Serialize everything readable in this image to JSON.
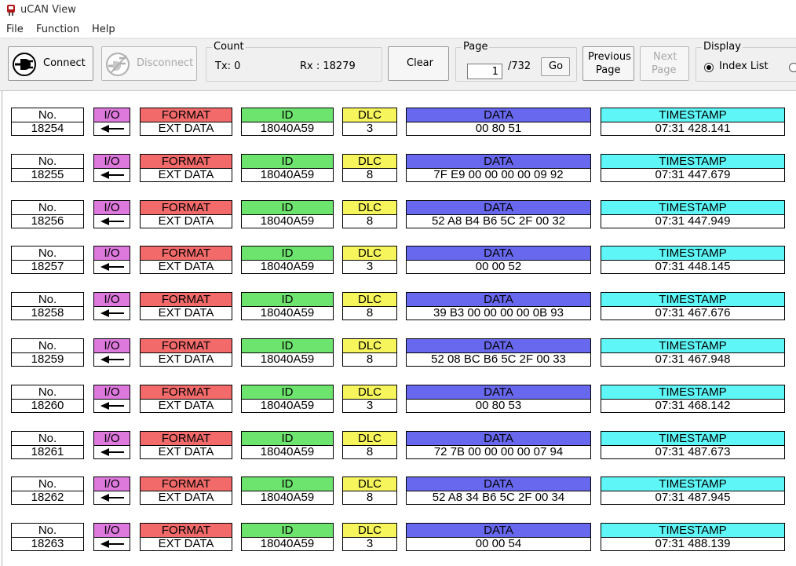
{
  "window": {
    "title": "uCAN View"
  },
  "menu": [
    "File",
    "Function",
    "Help"
  ],
  "toolbar": {
    "connect": "Connect",
    "disconnect": "Disconnect",
    "count": {
      "label": "Count",
      "tx": "Tx:  0",
      "rx": "Rx : 18279"
    },
    "clear": "Clear",
    "page": {
      "label": "Page",
      "current": "1",
      "total": "/732",
      "go": "Go"
    },
    "previous_page": [
      "Previous",
      "Page"
    ],
    "next_page": [
      "Next",
      "Page"
    ],
    "display": {
      "label": "Display",
      "option": "Index List"
    }
  },
  "headers": {
    "no": "No.",
    "io": "I/O",
    "format": "FORMAT",
    "id": "ID",
    "dlc": "DLC",
    "data": "DATA",
    "timestamp": "TIMESTAMP"
  },
  "colors": {
    "no": "#ffffff",
    "io": "#dd78dd",
    "format": "#f26a6a",
    "id": "#6de46d",
    "dlc": "#f6f65c",
    "data": "#6868ee",
    "timestamp": "#5ef6f6"
  },
  "records": [
    {
      "no": "18254",
      "format": "EXT DATA",
      "id": "18040A59",
      "dlc": "3",
      "data": "00 80 51",
      "timestamp": "07:31  428.141"
    },
    {
      "no": "18255",
      "format": "EXT DATA",
      "id": "18040A59",
      "dlc": "8",
      "data": "7F E9 00 00 00 00 09 92",
      "timestamp": "07:31  447.679"
    },
    {
      "no": "18256",
      "format": "EXT DATA",
      "id": "18040A59",
      "dlc": "8",
      "data": "52 A8 B4 B6 5C 2F 00 32",
      "timestamp": "07:31  447.949"
    },
    {
      "no": "18257",
      "format": "EXT DATA",
      "id": "18040A59",
      "dlc": "3",
      "data": "00 00 52",
      "timestamp": "07:31  448.145"
    },
    {
      "no": "18258",
      "format": "EXT DATA",
      "id": "18040A59",
      "dlc": "8",
      "data": "39 B3 00 00 00 00 0B 93",
      "timestamp": "07:31  467.676"
    },
    {
      "no": "18259",
      "format": "EXT DATA",
      "id": "18040A59",
      "dlc": "8",
      "data": "52 08 BC B6 5C 2F 00 33",
      "timestamp": "07:31  467.948"
    },
    {
      "no": "18260",
      "format": "EXT DATA",
      "id": "18040A59",
      "dlc": "3",
      "data": "00 80 53",
      "timestamp": "07:31  468.142"
    },
    {
      "no": "18261",
      "format": "EXT DATA",
      "id": "18040A59",
      "dlc": "8",
      "data": "72 7B 00 00 00 00 07 94",
      "timestamp": "07:31  487.673"
    },
    {
      "no": "18262",
      "format": "EXT DATA",
      "id": "18040A59",
      "dlc": "8",
      "data": "52 A8 34 B6 5C 2F 00 34",
      "timestamp": "07:31  487.945"
    },
    {
      "no": "18263",
      "format": "EXT DATA",
      "id": "18040A59",
      "dlc": "3",
      "data": "00 00 54",
      "timestamp": "07:31  488.139"
    }
  ]
}
